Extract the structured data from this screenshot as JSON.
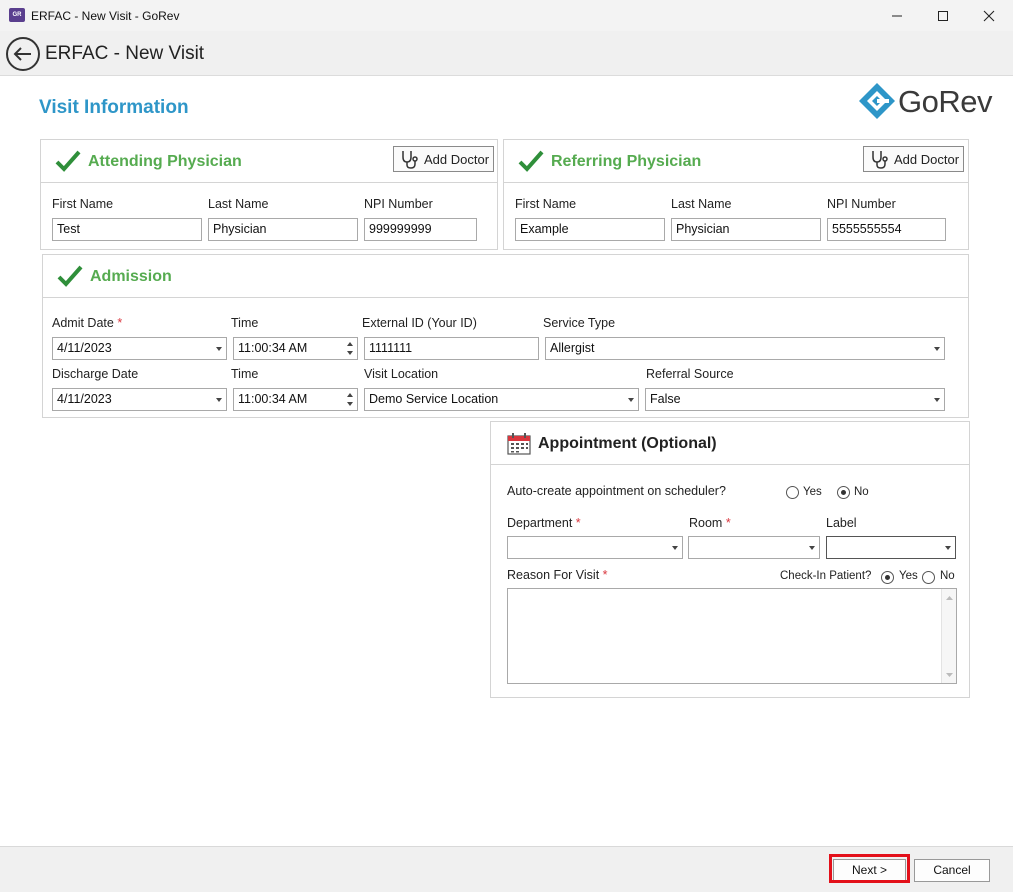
{
  "window": {
    "app_icon_text": "GR",
    "title": "ERFAC - New Visit - GoRev",
    "minimize": "—",
    "maximize": "☐",
    "close": "✕"
  },
  "header": {
    "title": "ERFAC - New Visit"
  },
  "page": {
    "section_title": "Visit Information",
    "logo_text": "GoRev"
  },
  "attending": {
    "title": "Attending Physician",
    "add_doctor": "Add Doctor",
    "first_name_label": "First Name",
    "first_name": "Test",
    "last_name_label": "Last Name",
    "last_name": "Physician",
    "npi_label": "NPI Number",
    "npi": "999999999"
  },
  "referring": {
    "title": "Referring Physician",
    "add_doctor": "Add Doctor",
    "first_name_label": "First Name",
    "first_name": "Example",
    "last_name_label": "Last Name",
    "last_name": "Physician",
    "npi_label": "NPI Number",
    "npi": "5555555554"
  },
  "admission": {
    "title": "Admission",
    "admit_date_label": "Admit Date",
    "admit_date": "4/11/2023",
    "admit_time_label": "Time",
    "admit_time": "11:00:34 AM",
    "external_id_label": "External ID (Your ID)",
    "external_id": "1111111",
    "service_type_label": "Service Type",
    "service_type": "Allergist",
    "discharge_date_label": "Discharge Date",
    "discharge_date": "4/11/2023",
    "discharge_time_label": "Time",
    "discharge_time": "11:00:34 AM",
    "visit_location_label": "Visit Location",
    "visit_location": "Demo Service Location",
    "referral_source_label": "Referral Source",
    "referral_source": "False",
    "required_mark": "*"
  },
  "appointment": {
    "title": "Appointment (Optional)",
    "auto_create_label": "Auto-create appointment on scheduler?",
    "yes": "Yes",
    "no": "No",
    "auto_create_selected": "No",
    "department_label": "Department",
    "department": "",
    "room_label": "Room",
    "room": "",
    "label_label": "Label",
    "label": "",
    "reason_label": "Reason For Visit",
    "reason": "",
    "checkin_label": "Check-In Patient?",
    "checkin_selected": "Yes",
    "required_mark": "*"
  },
  "footer": {
    "next": "Next >",
    "cancel": "Cancel"
  },
  "colors": {
    "accent_blue": "#2e96c8",
    "check_green": "#2f8f3a",
    "title_green": "#56ab50",
    "required_red": "#d9363e",
    "highlight_red": "#e3101a"
  }
}
